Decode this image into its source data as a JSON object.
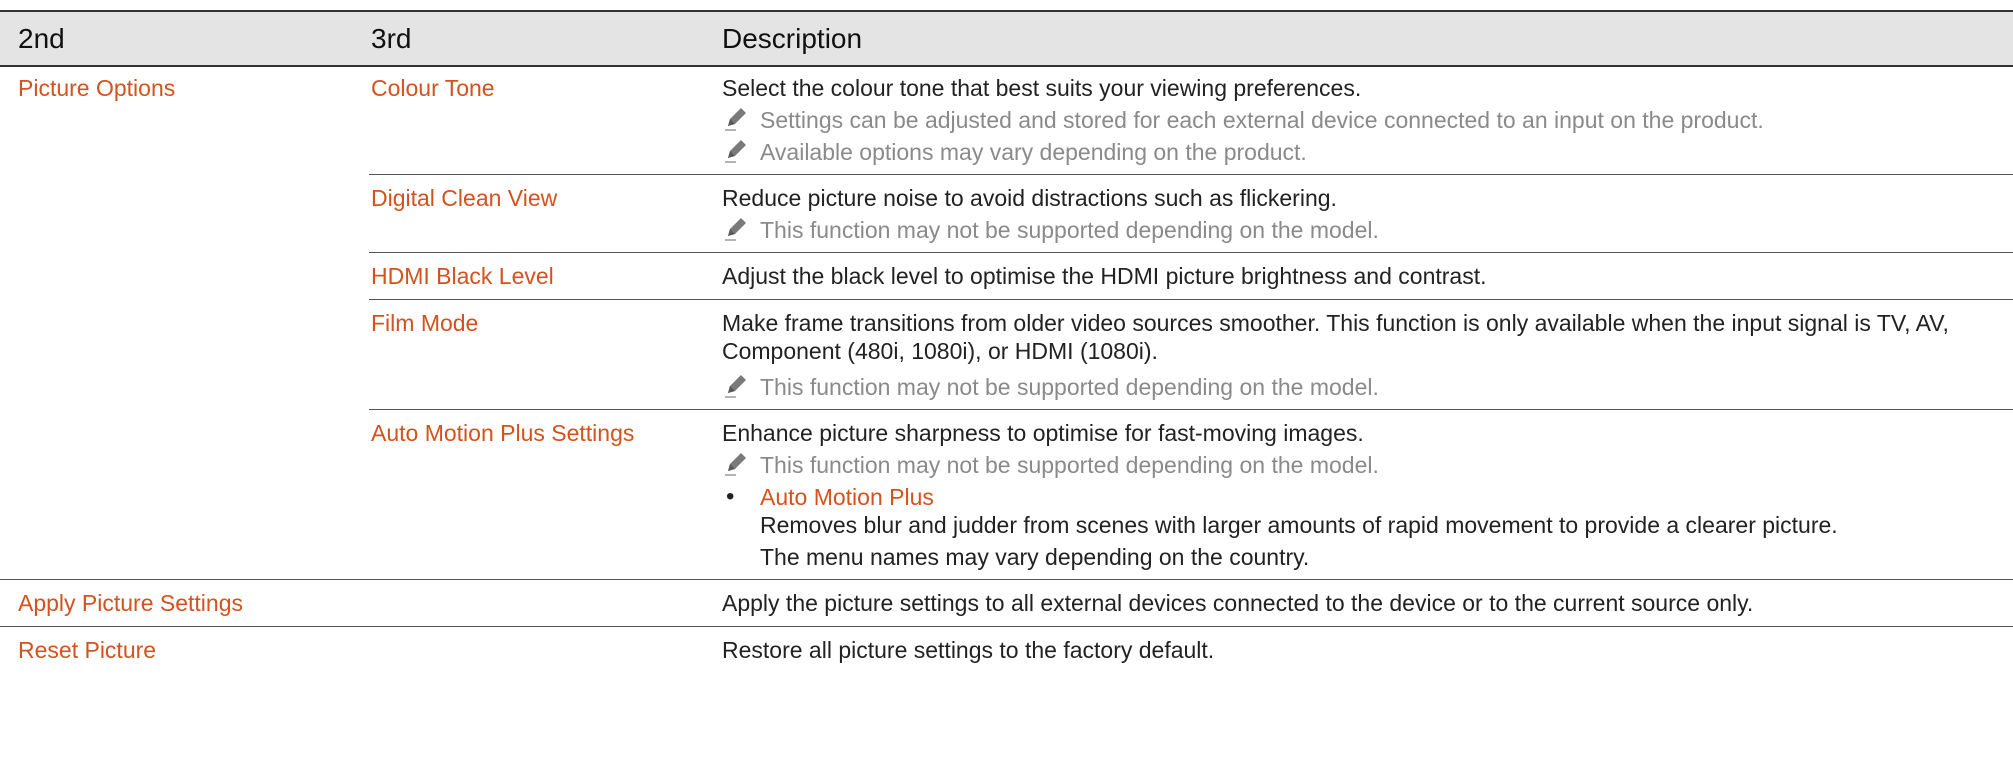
{
  "header": {
    "col1": "2nd",
    "col2": "3rd",
    "col3": "Description"
  },
  "picture_options": {
    "label": "Picture Options",
    "items": [
      {
        "label": "Colour Tone",
        "desc": "Select the colour tone that best suits your viewing preferences.",
        "notes": [
          "Settings can be adjusted and stored for each external device connected to an input on the product.",
          "Available options may vary depending on the product."
        ]
      },
      {
        "label": "Digital Clean View",
        "desc": "Reduce picture noise to avoid distractions such as flickering.",
        "notes": [
          "This function may not be supported depending on the model."
        ]
      },
      {
        "label": "HDMI Black Level",
        "desc": "Adjust the black level to optimise the HDMI picture brightness and contrast."
      },
      {
        "label": "Film Mode",
        "desc_line1": "Make frame transitions from older video sources smoother. This function is only available when the input signal is TV, AV,",
        "desc_line2": "Component (480i, 1080i), or HDMI (1080i).",
        "notes": [
          "This function may not be supported depending on the model."
        ]
      },
      {
        "label": "Auto Motion Plus Settings",
        "desc": "Enhance picture sharpness to optimise for fast-moving images.",
        "notes": [
          "This function may not be supported depending on the model."
        ],
        "bullet_title": "Auto Motion Plus",
        "bullet_desc": "Removes blur and judder from scenes with larger amounts of rapid movement to provide a clearer picture.",
        "bullet_note": "The menu names may vary depending on the country."
      }
    ]
  },
  "apply_picture_settings": {
    "label": "Apply Picture Settings",
    "desc": "Apply the picture settings to all external devices connected to the device or to the current source only."
  },
  "reset_picture": {
    "label": "Reset Picture",
    "desc": "Restore all picture settings to the factory default."
  },
  "colors": {
    "accent": "#d4521d",
    "note": "#8a8a8a",
    "header_bg": "#e4e4e4"
  },
  "icons": {
    "note": "pencil-icon",
    "bullet": "bullet-dot"
  }
}
